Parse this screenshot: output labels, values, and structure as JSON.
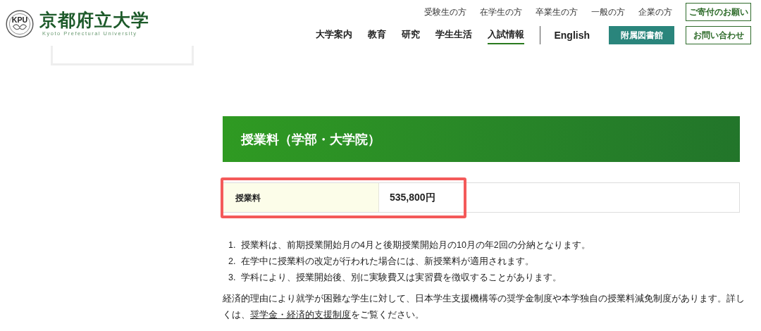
{
  "logo": {
    "mark": "KPU",
    "title": "京都府立大学",
    "subtitle": "Kyoto Prefectural University"
  },
  "audience_links": [
    "受験生の方",
    "在学生の方",
    "卒業生の方",
    "一般の方",
    "企業の方"
  ],
  "nav": [
    {
      "label": "大学案内",
      "selected": false
    },
    {
      "label": "教育",
      "selected": false
    },
    {
      "label": "研究",
      "selected": false
    },
    {
      "label": "学生生活",
      "selected": false
    },
    {
      "label": "入試情報",
      "selected": true
    }
  ],
  "language_link": "English",
  "library_button": "附属図書館",
  "donation_button": "ご寄付のお願い",
  "contact_button": "お問い合わせ",
  "section_title": "授業料（学部・大学院）",
  "fee_table": {
    "label": "授業料",
    "value": "535,800円",
    "highlighted": true
  },
  "notes": [
    "授業料は、前期授業開始月の4月と後期授業開始月の10月の年2回の分納となります。",
    "在学中に授業料の改定が行われた場合には、新授業料が適用されます。",
    "学科により、授業開始後、別に実験費又は実習費を徴収することがあります。"
  ],
  "note_markers": [
    "1.",
    "2.",
    "3."
  ],
  "paragraph": {
    "before": "経済的理由により就学が困難な学生に対して、日本学生支援機構等の奨学金制度や本学独自の授業料減免制度があります。詳しくは、",
    "link": "奨学金・経済的支援制度",
    "after": "をご覧ください。"
  }
}
